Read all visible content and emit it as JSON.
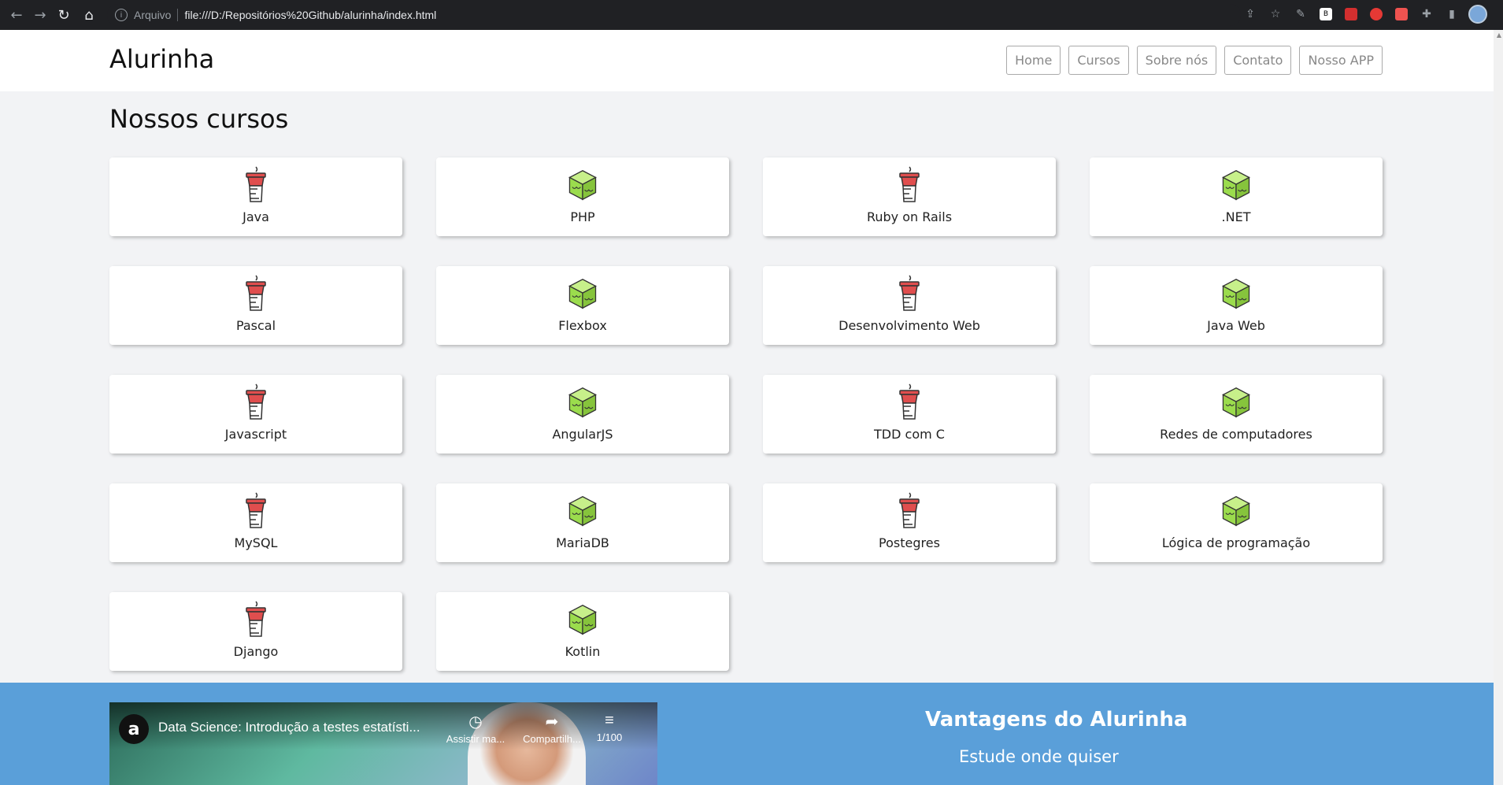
{
  "browser": {
    "scheme_label": "Arquivo",
    "url": "file:///D:/Repositórios%20Github/alurinha/index.html"
  },
  "header": {
    "brand": "Alurinha",
    "menu": [
      "Home",
      "Cursos",
      "Sobre nós",
      "Contato",
      "Nosso APP"
    ]
  },
  "courses": {
    "title": "Nossos cursos",
    "items": [
      {
        "label": "Java",
        "icon": "cup-icon"
      },
      {
        "label": "PHP",
        "icon": "cube-icon"
      },
      {
        "label": "Ruby on Rails",
        "icon": "cup-icon"
      },
      {
        "label": ".NET",
        "icon": "cube-icon"
      },
      {
        "label": "Pascal",
        "icon": "cup-icon"
      },
      {
        "label": "Flexbox",
        "icon": "cube-icon"
      },
      {
        "label": "Desenvolvimento Web",
        "icon": "cup-icon"
      },
      {
        "label": "Java Web",
        "icon": "cube-icon"
      },
      {
        "label": "Javascript",
        "icon": "cup-icon"
      },
      {
        "label": "AngularJS",
        "icon": "cube-icon"
      },
      {
        "label": "TDD com C",
        "icon": "cup-icon"
      },
      {
        "label": "Redes de computadores",
        "icon": "cube-icon"
      },
      {
        "label": "MySQL",
        "icon": "cup-icon"
      },
      {
        "label": "MariaDB",
        "icon": "cube-icon"
      },
      {
        "label": "Postegres",
        "icon": "cup-icon"
      },
      {
        "label": "Lógica de programação",
        "icon": "cube-icon"
      },
      {
        "label": "Django",
        "icon": "cup-icon"
      },
      {
        "label": "Kotlin",
        "icon": "cube-icon"
      }
    ]
  },
  "features": {
    "video_title": "Data Science: Introdução a testes estatísti...",
    "video_watch": "Assistir ma...",
    "video_share": "Compartilh...",
    "video_count": "1/100",
    "title": "Vantagens do Alurinha",
    "item": "Estude onde quiser"
  },
  "colors": {
    "cup": "#e04e4e",
    "cube": "#9bdc4d",
    "features_bg": "#5a9fd9"
  }
}
